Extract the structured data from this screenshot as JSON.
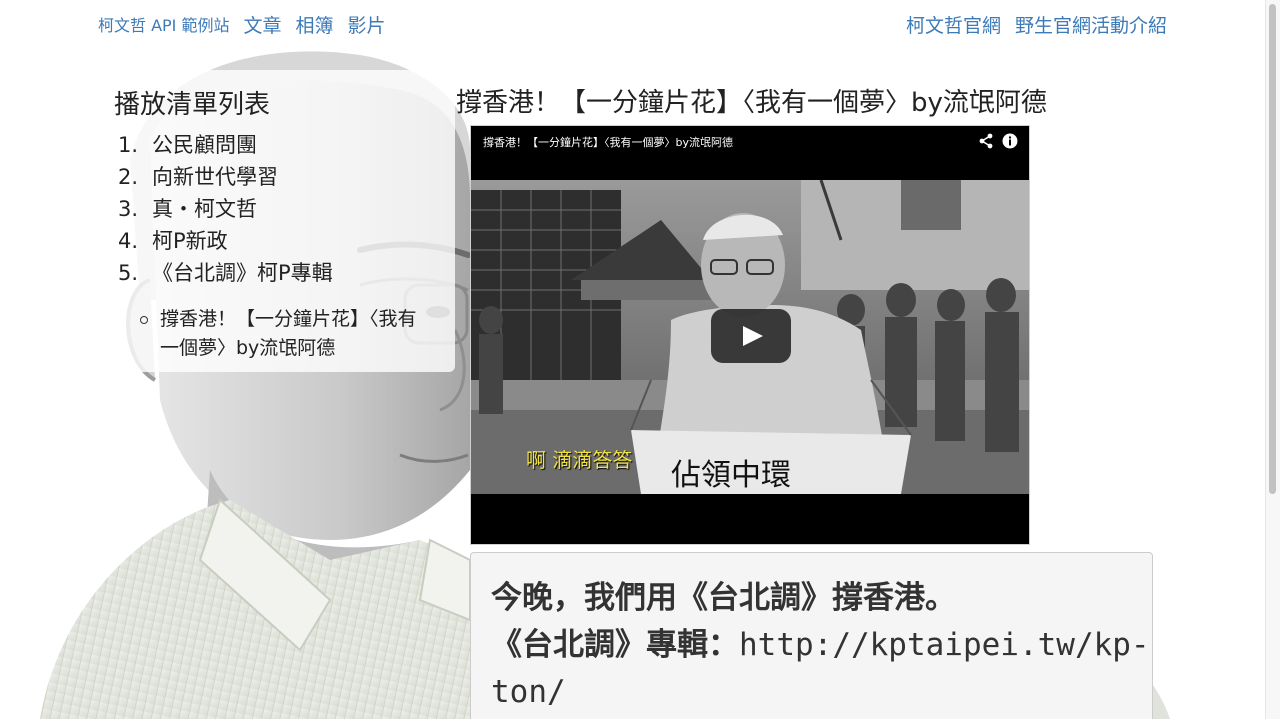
{
  "nav": {
    "brand": "柯文哲 API 範例站",
    "left_links": [
      "文章",
      "相簿",
      "影片"
    ],
    "right_links": [
      "柯文哲官網",
      "野生官網活動介紹"
    ]
  },
  "playlist": {
    "title": "播放清單列表",
    "items": [
      {
        "num": "1.",
        "label": "公民顧問團"
      },
      {
        "num": "2.",
        "label": "向新世代學習"
      },
      {
        "num": "3.",
        "label": "真・柯文哲"
      },
      {
        "num": "4.",
        "label": "柯P新政"
      },
      {
        "num": "5.",
        "label": "《台北調》柯P專輯"
      }
    ],
    "sub_items": [
      "撐香港！【一分鐘片花】〈我有一個夢〉by流氓阿德"
    ]
  },
  "video": {
    "title": "撐香港！【一分鐘片花】〈我有一個夢〉by流氓阿德",
    "player_title": "撐香港！【一分鐘片花】〈我有一個夢〉by流氓阿德",
    "caption": "啊 滴滴答答",
    "banner_text": "佔領中環"
  },
  "description": {
    "line1": "今晚，我們用《台北調》撐香港。",
    "line2_prefix": "《台北調》專輯：",
    "url": "http://kptaipei.tw/kp-ton/"
  },
  "colors": {
    "link": "#3d7ab8",
    "panel_bg": "#ffffff",
    "description_bg": "#f5f5f5",
    "video_caption": "#f0e243"
  },
  "icons": {
    "share": "share-icon",
    "info": "info-icon",
    "play": "play-icon"
  }
}
